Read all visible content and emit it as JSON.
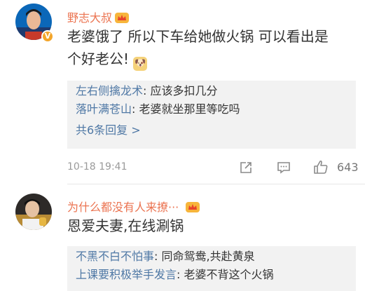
{
  "comment1": {
    "username": "野志大叔",
    "content_line1": "老婆饿了 所以下车给她做火锅 可以看出是",
    "content_line2": "个好老公!",
    "replies": [
      {
        "user": "左右侧擒龙术",
        "text": ": 应该多扣几分"
      },
      {
        "user": "落叶满苍山",
        "text": ": 老婆就坐那里等吃吗"
      }
    ],
    "more_replies": "共6条回复 >",
    "timestamp": "10-18 19:41",
    "likes": "643"
  },
  "comment2": {
    "username": "为什么都没有人来撩···",
    "content": "恩爱夫妻,在线涮锅",
    "replies": [
      {
        "user": "不黑不白不怕事",
        "text": ": 同命鸳鸯,共赴黄泉"
      },
      {
        "user": "上课要积极举手发言",
        "text": ":  老婆不背这个火锅"
      }
    ]
  },
  "icons": {
    "vip": "crown-badge-icon",
    "verified": "verified-v-icon",
    "emoji": "doge-emoji-icon",
    "share": "share-icon",
    "comment": "comment-icon",
    "like": "thumbs-up-icon"
  },
  "colors": {
    "username": "#eb7350",
    "reply_user": "#4f78a5",
    "reply_bg": "#f2f2f2",
    "meta": "#9a9a9a"
  }
}
